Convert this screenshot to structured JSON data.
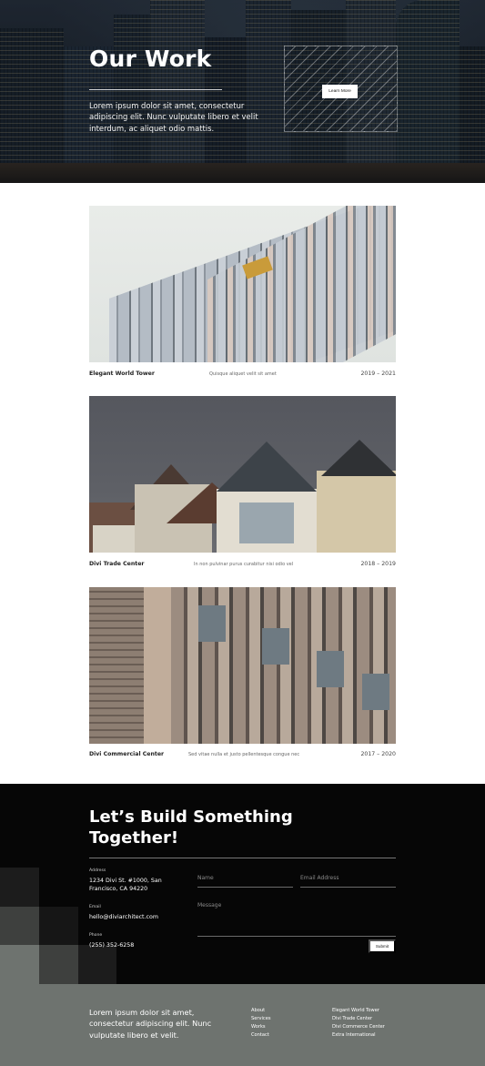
{
  "hero": {
    "title": "Our Work",
    "text": "Lorem ipsum dolor sit amet, consectetur adipiscing elit. Nunc vulputate libero et velit interdum, ac aliquet odio mattis.",
    "button_label": "Learn More"
  },
  "projects": [
    {
      "title": "Elegant World Tower",
      "description": "Quisque aliquet velit sit amet",
      "dates": "2019 – 2021"
    },
    {
      "title": "Divi Trade Center",
      "description": "In non pulvinar purus curabitur nisi odio vel",
      "dates": "2018 – 2019"
    },
    {
      "title": "Divi Commercial Center",
      "description": "Sed vitae nulla et justo pellentesque congue nec",
      "dates": "2017 – 2020"
    }
  ],
  "contact": {
    "title": "Let’s Build Something Together!",
    "address_label": "Address",
    "address_value": "1234 Divi St. #1000, San Francisco, CA 94220",
    "email_label": "Email",
    "email_value": "hello@diviarchitect.com",
    "phone_label": "Phone",
    "phone_value": "(255) 352-6258",
    "name_placeholder": "Name",
    "email_placeholder": "Email Address",
    "message_placeholder": "Message",
    "submit_label": "Submit"
  },
  "footer": {
    "text": "Lorem ipsum dolor sit amet, consectetur adipiscing elit. Nunc vulputate libero et velit.",
    "nav_links": [
      "About",
      "Services",
      "Works",
      "Contact"
    ],
    "project_links": [
      "Elegant World Tower",
      "Divi Trade Center",
      "Divi Commerce Center",
      "Extra International"
    ]
  },
  "colors": {
    "contact_bg": "#060606",
    "footer_bg": "#6e736f",
    "accent_white": "#ffffff"
  }
}
